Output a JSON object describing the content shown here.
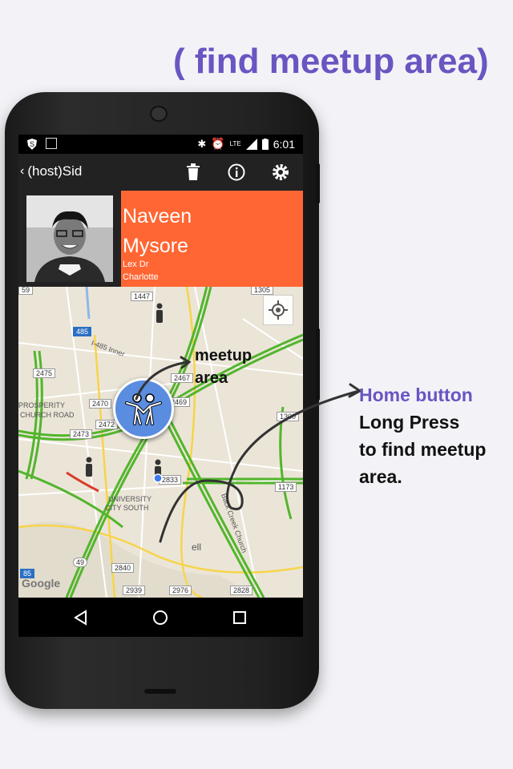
{
  "headline": "( find meetup area)",
  "status_bar": {
    "time": "6:01",
    "network": "LTE"
  },
  "action_bar": {
    "title": "(host)Sid"
  },
  "profile": {
    "first_name": "Naveen",
    "last_name": "Mysore",
    "street": "Lex Dr",
    "city": "Charlotte"
  },
  "map": {
    "road_labels": [
      "1447",
      "1305",
      "485",
      "I-485 Inner",
      "2475",
      "2467",
      "2470",
      "2472",
      "2469",
      "1300",
      "2473",
      "29",
      "2833",
      "1173",
      "49",
      "2840",
      "2939",
      "2976",
      "2828",
      "85",
      "59"
    ],
    "place_labels": [
      "PROSPERITY",
      "CHURCH ROAD",
      "UNIVERSITY",
      "CITY SOUTH",
      "Back Creek Church",
      "ell"
    ],
    "attribution": "Google"
  },
  "annotations": {
    "meetup_line1": "meetup",
    "meetup_line2": "area",
    "home_title": "Home button",
    "home_line1": "Long Press",
    "home_line2": "to find meetup",
    "home_line3": "area."
  },
  "colors": {
    "accent": "#6a55c2",
    "card": "#ff6633",
    "home_button": "#5a8ce0",
    "road_green": "#52b52c",
    "road_yellow": "#f7d44a"
  },
  "icons": [
    "trash-icon",
    "info-icon",
    "settings-icon",
    "my-location-icon",
    "meetup-people-icon",
    "back-nav-icon",
    "home-nav-icon",
    "recents-nav-icon"
  ]
}
